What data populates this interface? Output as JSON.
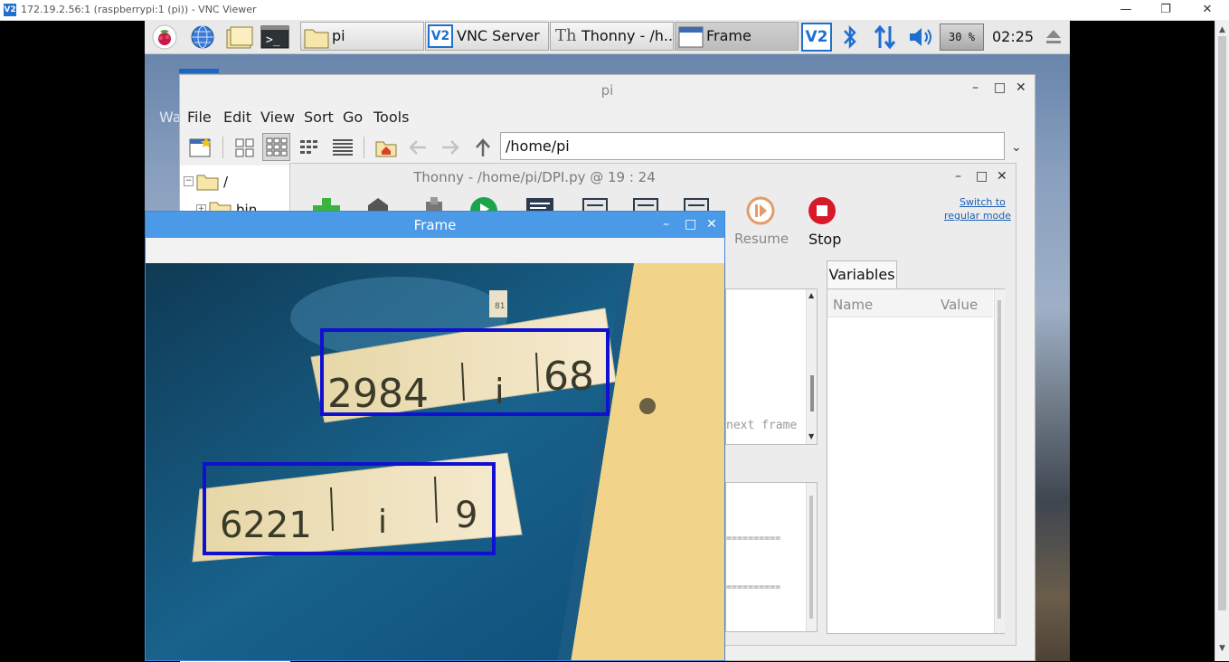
{
  "vnc": {
    "logo": "V2",
    "title": "172.19.2.56:1 (raspberrypi:1 (pi)) - VNC Viewer",
    "controls": {
      "minimize": "—",
      "restore": "❐",
      "close": "✕"
    }
  },
  "taskbar": {
    "icons": [
      "raspberry-menu-icon",
      "web-browser-icon",
      "file-manager-icon",
      "terminal-icon"
    ],
    "windows": [
      {
        "label": "pi",
        "icon": "folder-icon"
      },
      {
        "label": "VNC Server",
        "icon": "vnc-server-icon"
      },
      {
        "label": "Thonny  -  /h...",
        "icon": "thonny-icon"
      },
      {
        "label": "Frame",
        "icon": "window-icon",
        "active": true
      }
    ],
    "tray": {
      "vnc": "V2",
      "cpu": "30 %",
      "clock": "02:25"
    }
  },
  "desktop": {
    "partial_label": "Wa"
  },
  "pi_window": {
    "title": "pi",
    "menu": [
      "File",
      "Edit",
      "View",
      "Sort",
      "Go",
      "Tools"
    ],
    "path": "/home/pi",
    "tree": [
      {
        "label": "/"
      },
      {
        "label": "bin"
      }
    ],
    "controls": {
      "minimize": "–",
      "maximize": "□",
      "close": "✕"
    }
  },
  "thonny": {
    "title": "Thonny  -  /home/pi/DPI.py  @  19 : 24",
    "resume_label": "Resume",
    "stop_label": "Stop",
    "switch_mode": [
      "Switch to",
      "regular mode"
    ],
    "variables_tab": "Variables",
    "var_columns": [
      "Name",
      "Value"
    ],
    "editor_fragment": "next frame",
    "shell_lines": [
      "==========",
      "=========="
    ],
    "controls": {
      "minimize": "–",
      "maximize": "□",
      "close": "✕"
    }
  },
  "frame_window": {
    "title": "Frame",
    "plates": [
      {
        "digits": "2984",
        "mid": "i",
        "end": "68"
      },
      {
        "digits": "6221",
        "mid": "i",
        "end": "9"
      }
    ],
    "tag": "81",
    "controls": {
      "minimize": "–",
      "maximize": "□",
      "close": "✕"
    }
  },
  "colors": {
    "accent": "#4a9ae8",
    "box": "#1010d0",
    "stop": "#d8192a",
    "run": "#1aa54a"
  }
}
